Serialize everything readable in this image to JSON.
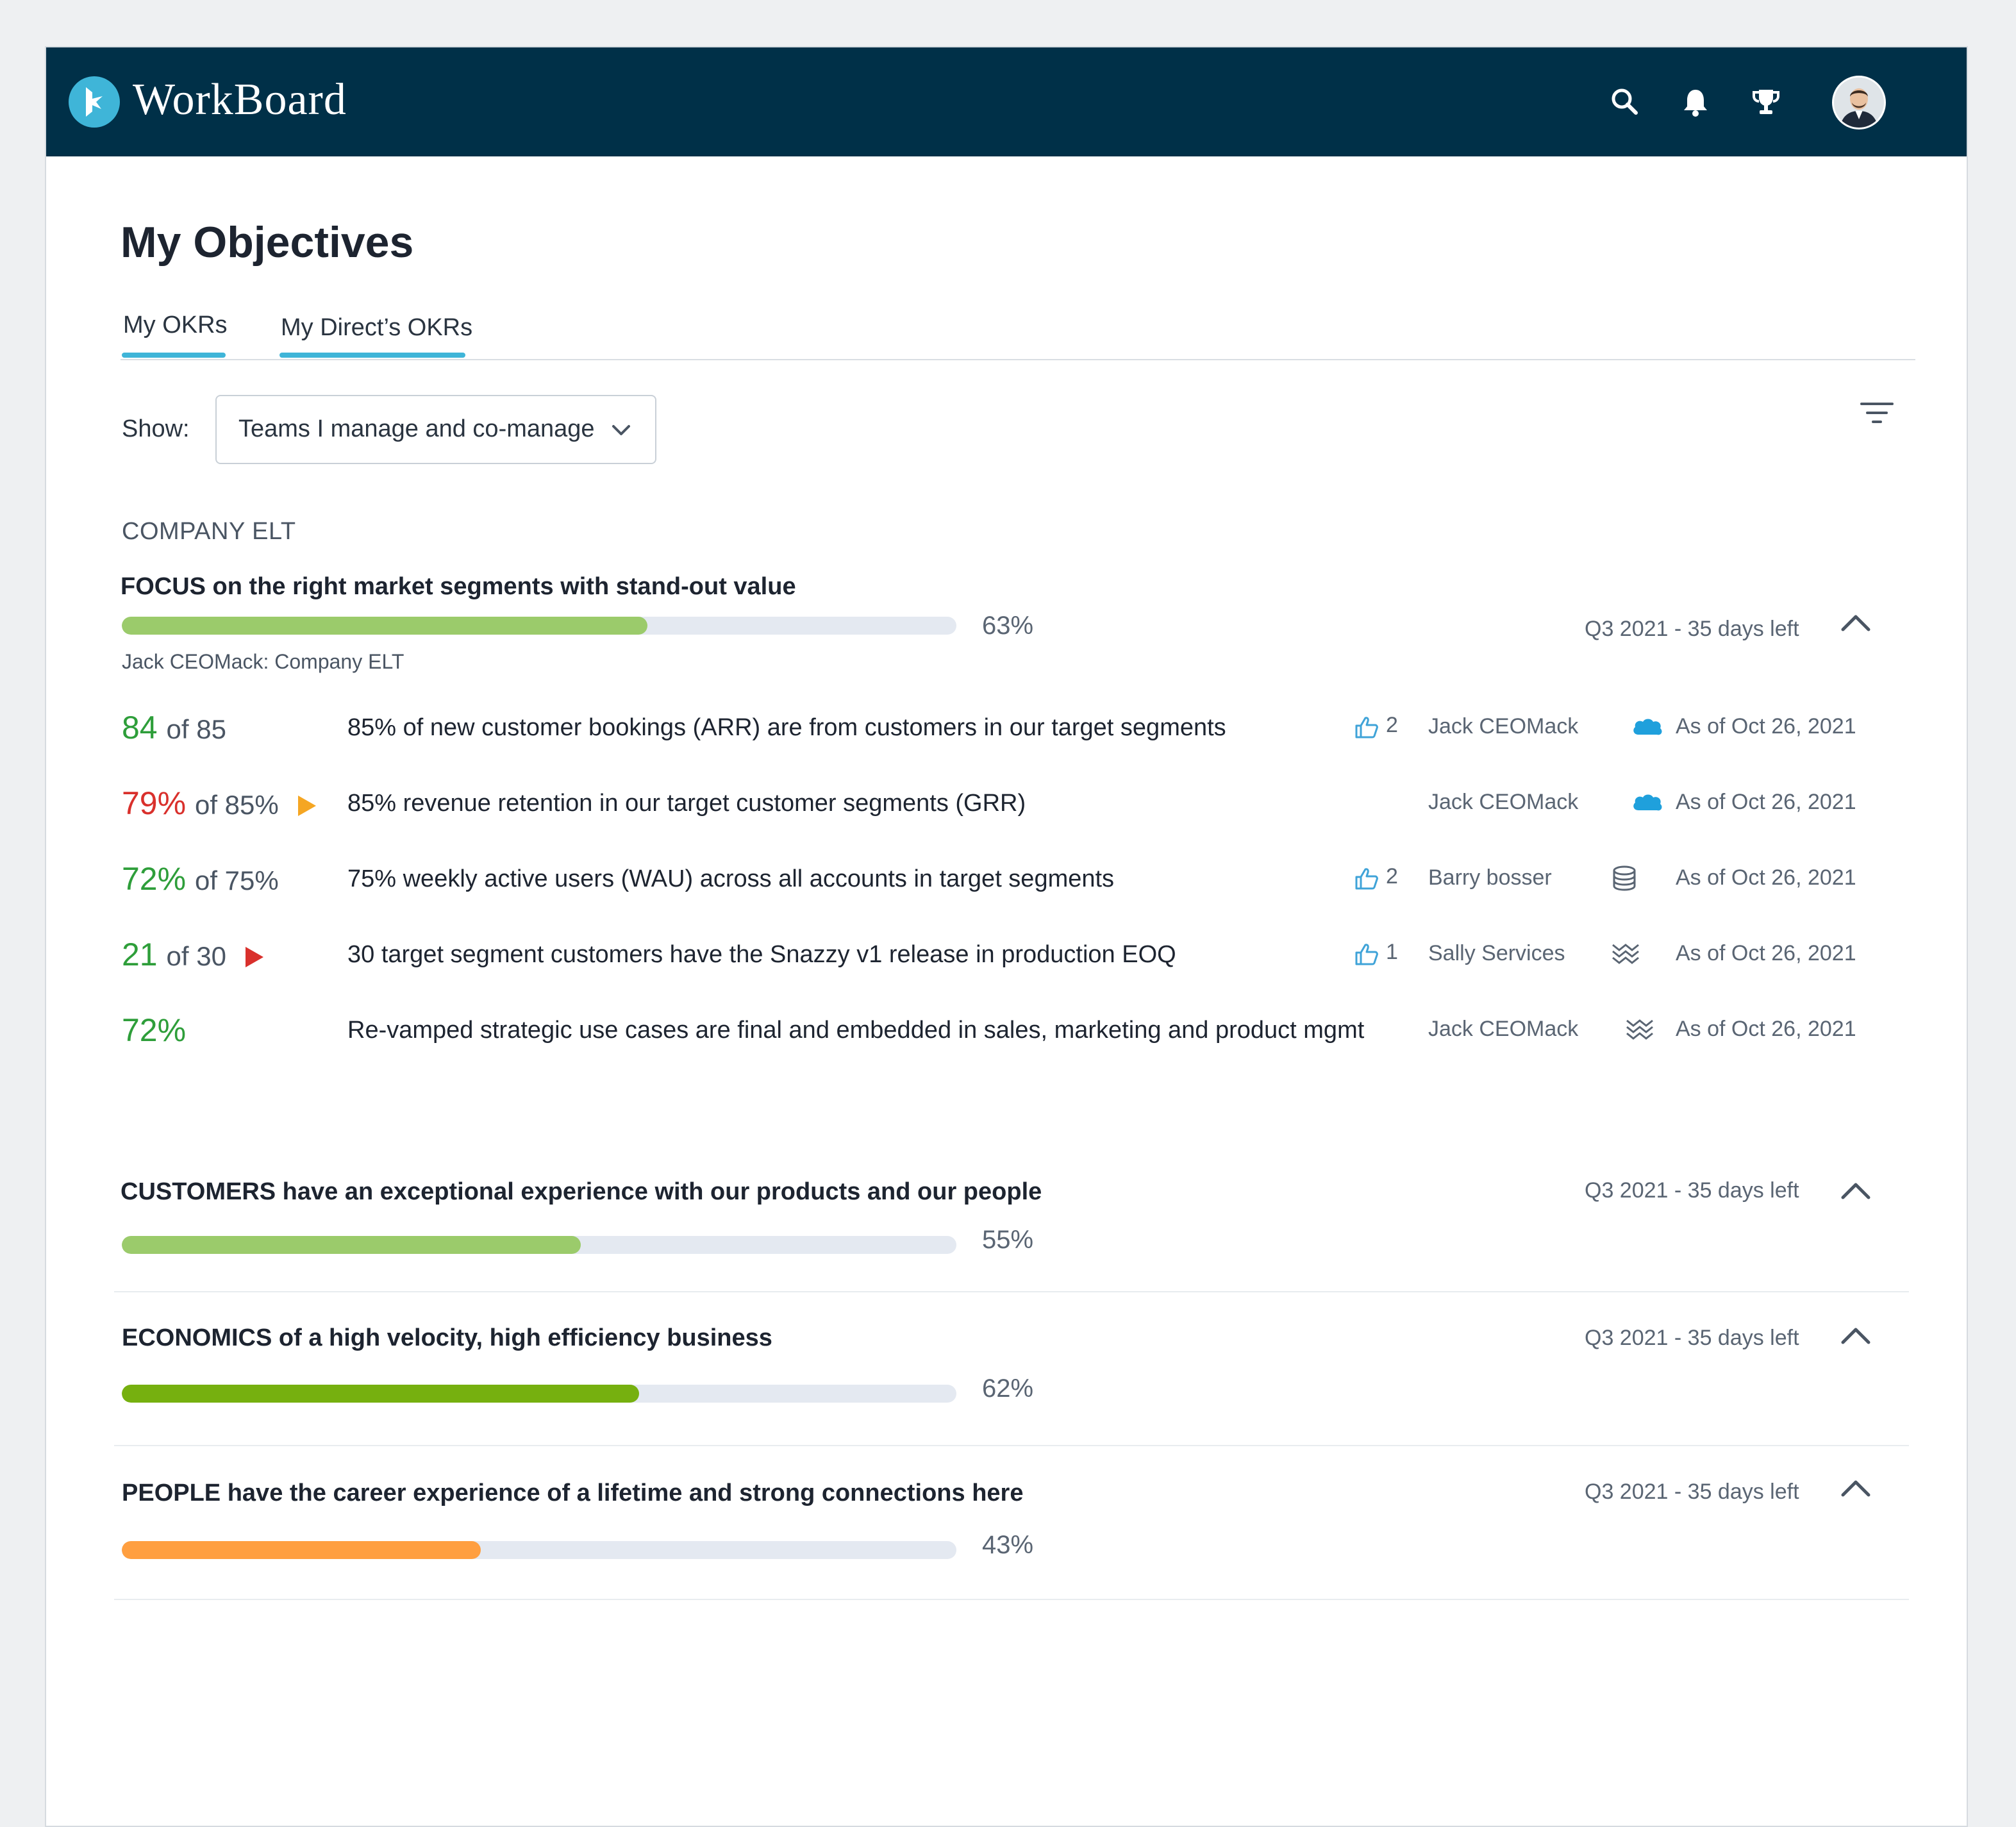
{
  "app": {
    "brand": "WorkBoard"
  },
  "header": {
    "icons": [
      "search-icon",
      "bell-icon",
      "trophy-icon"
    ],
    "avatar": "user-avatar"
  },
  "page": {
    "title": "My Objectives"
  },
  "tabs": [
    {
      "label": "My OKRs",
      "active": true
    },
    {
      "label": "My Direct’s OKRs",
      "active": false
    }
  ],
  "filter": {
    "show_label": "Show:",
    "selected": "Teams I manage and co-manage"
  },
  "section": {
    "heading": "COMPANY ELT"
  },
  "objectives": [
    {
      "title": "FOCUS on the right market segments with stand-out value",
      "progress": 0.63,
      "progress_label": "63%",
      "bar_color": "#9bcb6b",
      "quarter": "Q3 2021 - 35 days left",
      "owner": "Jack CEOMack: Company ELT",
      "key_results": [
        {
          "value": "84",
          "of": "of 85",
          "value_color": "#2e9e3a",
          "flag": "",
          "text": "85% of new customer bookings (ARR) are from customers in our target segments",
          "likes": "2",
          "owner": "Jack CEOMack",
          "source_icon": "salesforce-icon",
          "date": "As of Oct 26, 2021"
        },
        {
          "value": "79%",
          "of": "of 85%",
          "value_color": "#d9302c",
          "flag": "#f5a623",
          "text": "85% revenue retention in our target customer segments (GRR)",
          "likes": "",
          "owner": "Jack CEOMack",
          "source_icon": "salesforce-icon",
          "date": "As of Oct 26, 2021"
        },
        {
          "value": "72%",
          "of": "of 75%",
          "value_color": "#2e9e3a",
          "flag": "",
          "text": "75% weekly active users (WAU) across all accounts in target segments",
          "likes": "2",
          "owner": "Barry bosser",
          "source_icon": "database-icon",
          "date": "As of Oct 26, 2021"
        },
        {
          "value": "21",
          "of": "of 30",
          "value_color": "#2e9e3a",
          "flag": "#d9302c",
          "text": "30 target segment customers have the Snazzy v1 release in production EOQ",
          "likes": "1",
          "owner": "Sally Services",
          "source_icon": "waves-icon",
          "date": "As of Oct 26, 2021"
        },
        {
          "value": "72%",
          "of": "",
          "value_color": "#2e9e3a",
          "flag": "",
          "text": "Re-vamped strategic use cases are final and embedded in sales, marketing and product mgmt",
          "likes": "",
          "owner": "Jack CEOMack",
          "source_icon": "waves-icon",
          "date": "As of Oct 26, 2021"
        }
      ]
    },
    {
      "title": "CUSTOMERS have an exceptional experience with our products and our people",
      "progress": 0.55,
      "progress_label": "55%",
      "bar_color": "#9bcb6b",
      "quarter": "Q3 2021 - 35 days left"
    },
    {
      "title": "ECONOMICS of a high velocity, high efficiency business",
      "progress": 0.62,
      "progress_label": "62%",
      "bar_color": "#76b00f",
      "quarter": "Q3 2021 - 35 days left"
    },
    {
      "title": "PEOPLE have the career experience of a lifetime and strong connections here",
      "progress": 0.43,
      "progress_label": "43%",
      "bar_color": "#ff9f40",
      "quarter": "Q3 2021 - 35 days left"
    }
  ]
}
